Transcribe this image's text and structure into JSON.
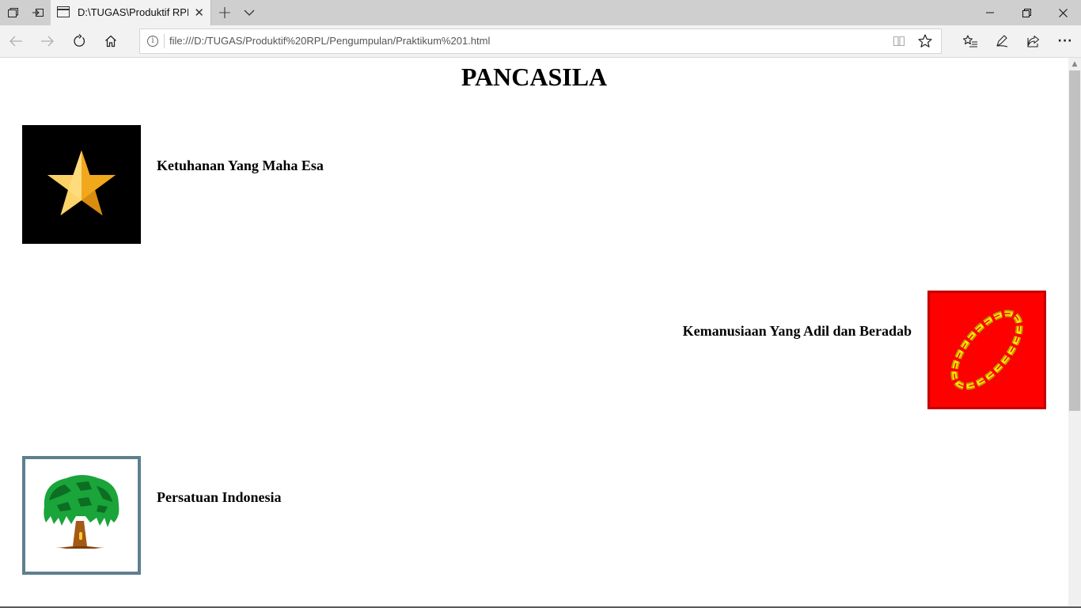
{
  "browser": {
    "tab": {
      "title": "D:\\TUGAS\\Produktif RPL"
    },
    "address": {
      "url": "file:///D:/TUGAS/Produktif%20RPL/Pengumpulan/Praktikum%201.html"
    },
    "icons": {
      "tab_actions": "tab-actions-icon",
      "set_aside": "set-aside-tabs-icon",
      "new_tab": "plus-icon",
      "tab_menu": "chevron-down-icon",
      "minimize": "minimize-icon",
      "restore": "restore-icon",
      "close": "close-icon",
      "back": "back-arrow-icon",
      "forward": "forward-arrow-icon",
      "refresh": "refresh-icon",
      "home": "home-icon",
      "site_info": "info-icon",
      "reading_view": "reading-view-icon",
      "favorite": "star-icon",
      "favorites_hub": "favorites-hub-icon",
      "notes": "pen-icon",
      "share": "share-icon",
      "more": "more-icon"
    },
    "symbols": {
      "tab_close": "✕",
      "new_tab": "+",
      "more": "···",
      "info": "i"
    }
  },
  "page": {
    "title": "PANCASILA",
    "sila": [
      {
        "label": "Ketuhanan Yang Maha Esa",
        "image": "star-emblem",
        "bg": "#000000",
        "accent": "#f5b82e"
      },
      {
        "label": "Kemanusiaan Yang Adil dan Beradab",
        "image": "chain-emblem",
        "bg": "#ff0000",
        "accent": "#ffd700"
      },
      {
        "label": "Persatuan Indonesia",
        "image": "banyan-tree-emblem",
        "bg": "#ffffff",
        "accent": "#1a9e3a"
      }
    ]
  }
}
